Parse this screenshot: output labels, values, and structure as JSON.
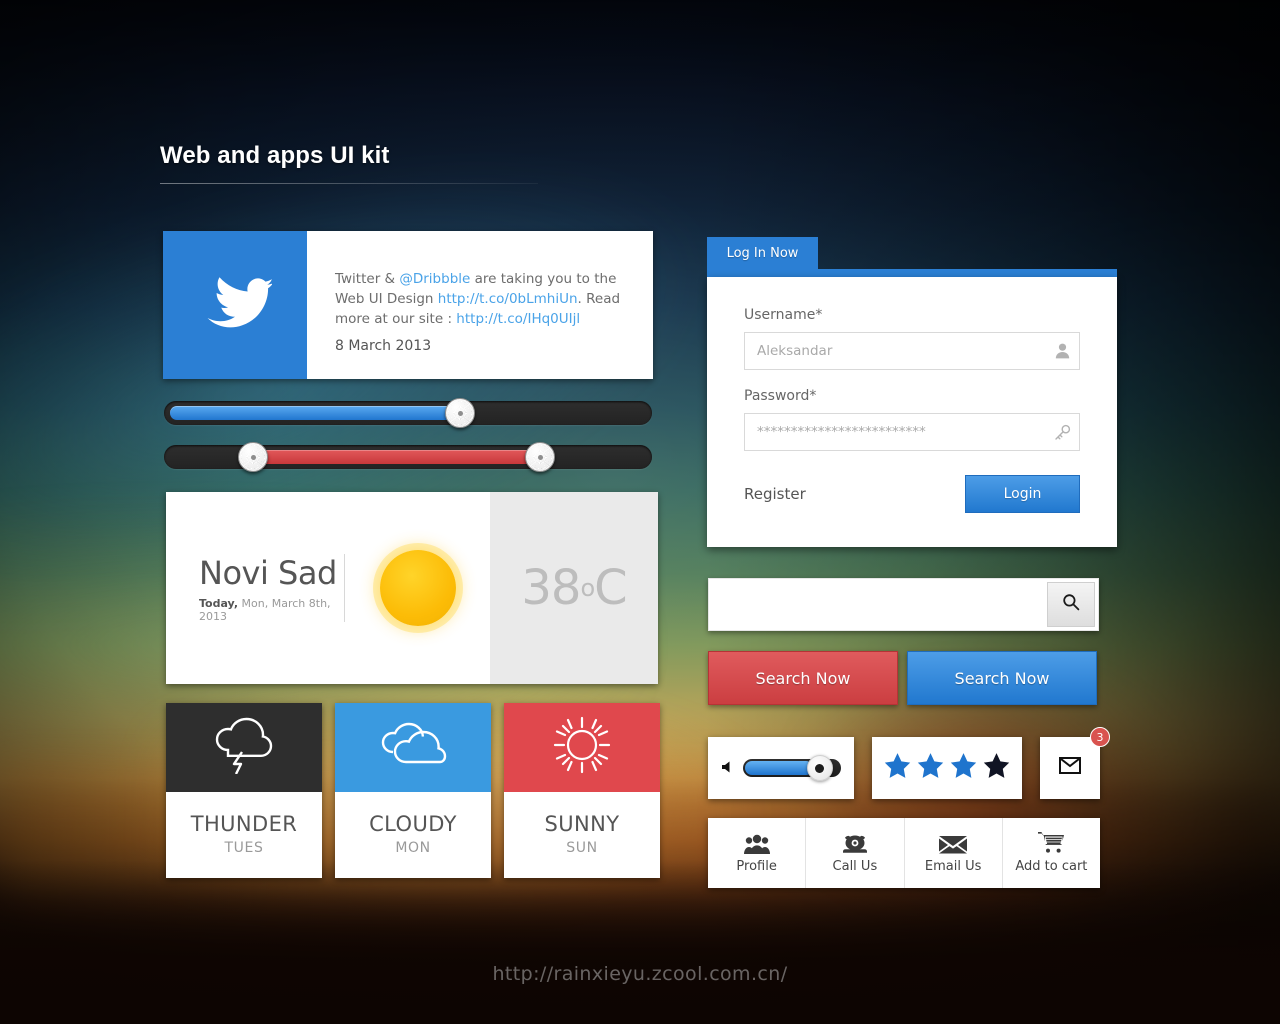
{
  "page": {
    "title": "Web and apps UI kit",
    "watermark": "http://rainxieyu.zcool.com.cn/"
  },
  "colors": {
    "brand_blue": "#2b7fd4",
    "accent_red": "#e0484d",
    "dark": "#2e2e2e",
    "sun_yellow": "#fcbc07",
    "badge_red": "#d9534f"
  },
  "tweet_card": {
    "icon": "twitter-bird-icon",
    "text_segments": [
      {
        "type": "text",
        "value": "Twitter & "
      },
      {
        "type": "link",
        "value": "@Dribbble"
      },
      {
        "type": "text",
        "value": " are taking you to the Web UI Design "
      },
      {
        "type": "link",
        "value": "http://t.co/0bLmhiUn"
      },
      {
        "type": "text",
        "value": ". Read more at our site : "
      },
      {
        "type": "link",
        "value": "http://t.co/IHq0UIjl"
      }
    ],
    "date": "8 March 2013"
  },
  "sliders": [
    {
      "name": "blue-slider",
      "color": "#2176cf",
      "value_percent": 60,
      "handles": 1
    },
    {
      "name": "red-slider",
      "color": "#c7383b",
      "value_low_percent": 17,
      "value_high_percent": 76,
      "handles": 2
    }
  ],
  "weather_main": {
    "city": "Novi Sad",
    "date_prefix": "Today,",
    "date_rest": " Mon, March 8th, 2013",
    "icon": "sun-icon",
    "temperature": "38",
    "degree_symbol": "o",
    "unit": "C"
  },
  "forecast": [
    {
      "icon": "thunder-cloud-icon",
      "name": "THUNDER",
      "day": "TUES",
      "accent": "#2e2e2e"
    },
    {
      "icon": "cloudy-icon",
      "name": "CLOUDY",
      "day": "MON",
      "accent": "#3a9ae0"
    },
    {
      "icon": "sunny-icon",
      "name": "SUNNY",
      "day": "SUN",
      "accent": "#e0484d"
    }
  ],
  "login": {
    "tab_label": "Log In Now",
    "username_label": "Username*",
    "username_value": "",
    "username_placeholder": "Aleksandar",
    "username_icon": "user-icon",
    "password_label": "Password*",
    "password_value": "",
    "password_placeholder": "*************************",
    "password_icon": "key-icon",
    "register_label": "Register",
    "login_button": "Login"
  },
  "search": {
    "value": "",
    "placeholder": "",
    "button_icon": "search-icon",
    "red_button": "Search Now",
    "blue_button": "Search Now"
  },
  "widgets": {
    "volume": {
      "icon": "speaker-icon",
      "value_percent": 68
    },
    "rating": {
      "filled": 3,
      "total": 4,
      "filled_color": "#1f74cd",
      "empty_color": "#101424"
    },
    "mail": {
      "icon": "envelope-icon",
      "badge_count": "3"
    }
  },
  "icon_bar": [
    {
      "icon": "people-icon",
      "label": "Profile"
    },
    {
      "icon": "telephone-icon",
      "label": "Call Us"
    },
    {
      "icon": "envelope-icon",
      "label": "Email Us"
    },
    {
      "icon": "shopping-cart-icon",
      "label": "Add to cart"
    }
  ]
}
